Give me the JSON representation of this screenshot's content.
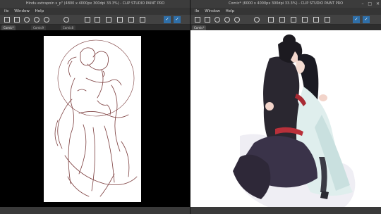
{
  "left_window": {
    "title": "Hindu extrapoin s_p\" (4800 x 4000px 300dpi 33.3%) - CLIP STUDIO PAINT PRO",
    "menu": [
      "ile",
      "Window",
      "Help"
    ],
    "tabs": [
      "Comic*",
      "Comic9",
      "Comic8"
    ],
    "active_tab_index": 0
  },
  "right_window": {
    "title": "Comic* (6000 x 4000px 300dpi 33.3%) - CLIP STUDIO PAINT PRO",
    "menu": [
      "ile",
      "Window",
      "Help"
    ],
    "tabs": [
      "Comic*"
    ],
    "active_tab_index": 0
  },
  "window_controls": [
    "minimize-icon",
    "maximize-icon",
    "close-icon"
  ],
  "canvas_descriptions": {
    "left": "sketch",
    "right": "colored illustration"
  },
  "colors": {
    "toolbar_active": "#2f6fa8",
    "chrome_dark": "#2b2b2b",
    "canvas_left_bg": "#000000",
    "canvas_right_bg": "#ffffff",
    "sketch_line": "#7a3b3b"
  }
}
